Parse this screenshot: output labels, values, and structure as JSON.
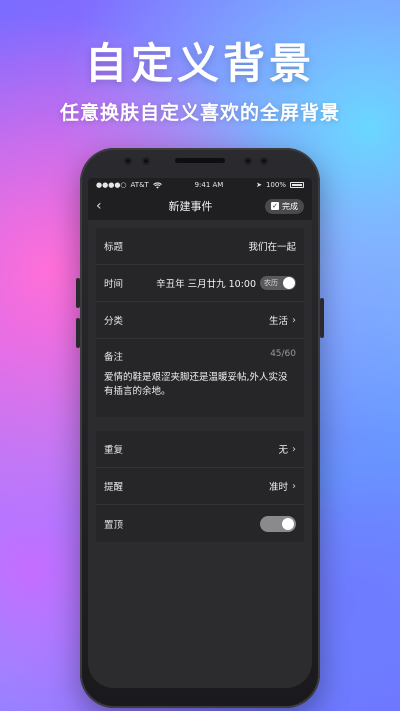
{
  "promo": {
    "headline": "自定义背景",
    "subline": "任意换肤自定义喜欢的全屏背景"
  },
  "status_bar": {
    "signal": "●●●●○",
    "carrier": "AT&T",
    "wifi_icon": "wifi-icon",
    "time": "9:41 AM",
    "battery": "100%"
  },
  "nav": {
    "back_icon": "‹",
    "title": "新建事件",
    "done_label": "完成"
  },
  "form": {
    "title": {
      "label": "标题",
      "value": "我们在一起"
    },
    "time": {
      "label": "时间",
      "value": "辛丑年 三月廿九 10:00",
      "lunar_label": "农历",
      "lunar_on": true
    },
    "category": {
      "label": "分类",
      "value": "生活"
    },
    "note": {
      "label": "备注",
      "count": "45/60",
      "text": "爱情的鞋是艰涩夹脚还是温暖妥帖,外人实没有插言的余地。"
    },
    "repeat": {
      "label": "重复",
      "value": "无"
    },
    "reminder": {
      "label": "提醒",
      "value": "准时"
    },
    "pin": {
      "label": "置顶",
      "on": true
    }
  },
  "icons": {
    "chevron": "›",
    "check": "✓"
  }
}
